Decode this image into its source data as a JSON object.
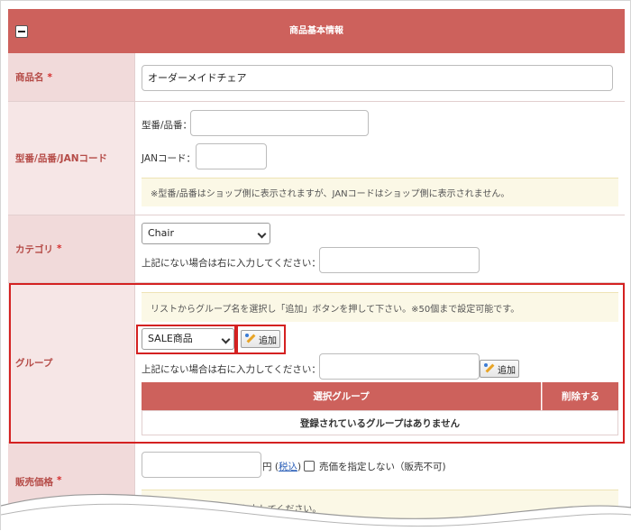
{
  "header": {
    "title": "商品基本情報",
    "toggle": "collapse-icon"
  },
  "product_name": {
    "label": "商品名",
    "required": "*",
    "value": "オーダーメイドチェア"
  },
  "model": {
    "label": "型番/品番/JANコード",
    "model_label": "型番/品番：",
    "jan_label": "JANコード：",
    "note": "※型番/品番はショップ側に表示されますが、JANコードはショップ側に表示されません。"
  },
  "category": {
    "label": "カテゴリ",
    "required": "*",
    "selected": "Chair",
    "hint": "上記にない場合は右に入力してください："
  },
  "group": {
    "label": "グループ",
    "note": "リストからグループ名を選択し「追加」ボタンを押して下さい。※50個まで設定可能です。",
    "selected": "SALE商品",
    "add_button": "追加",
    "hint": "上記にない場合は右に入力してください：",
    "add_button_2": "追加",
    "table_header_group": "選択グループ",
    "table_header_delete": "削除する",
    "empty": "登録されているグループはありません"
  },
  "price": {
    "label": "販売価格",
    "required": "*",
    "unit": "円",
    "tax_open": "(",
    "tax_link": "税込",
    "tax_close": ")",
    "no_price": "売価を指定しない（販売不可)",
    "note_partial": "入力してください。"
  },
  "colors": {
    "accent": "#cd615c",
    "highlight": "#d42121",
    "label_bg": "#f1dada"
  }
}
